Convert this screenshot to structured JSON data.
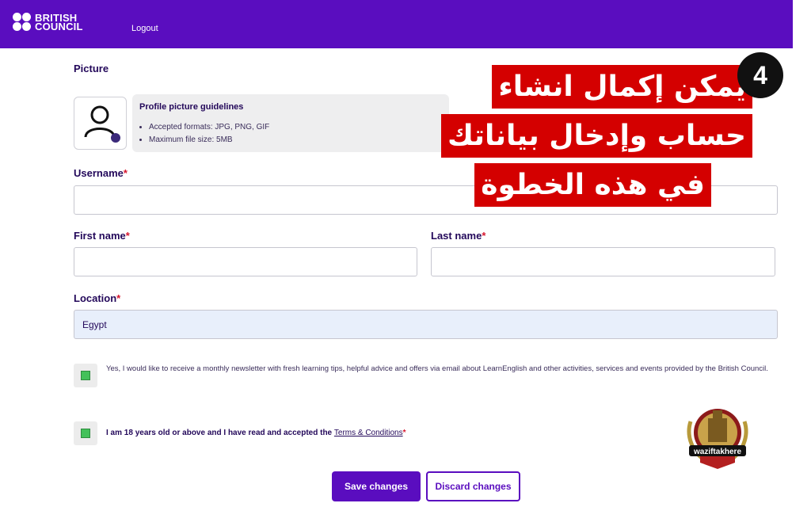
{
  "header": {
    "logo_line1": "BRITISH",
    "logo_line2": "COUNCIL",
    "logout": "Logout"
  },
  "picture": {
    "label": "Picture",
    "avatar_icon": "user-icon",
    "guidelines_title": "Profile picture guidelines",
    "guidelines": [
      "Accepted formats: JPG, PNG, GIF",
      "Maximum file size: 5MB"
    ]
  },
  "form": {
    "username_label": "Username",
    "username_value": "",
    "first_name_label": "First name",
    "first_name_value": "",
    "last_name_label": "Last name",
    "last_name_value": "",
    "location_label": "Location",
    "location_value": "Egypt",
    "required_mark": "*"
  },
  "consent": {
    "newsletter_text": "Yes, I would like to receive a monthly newsletter with fresh learning tips, helpful advice and offers via email about LearnEnglish and other activities, services and events provided by the British Council.",
    "newsletter_checked": true,
    "age_text": "I am 18 years old or above and I have read and accepted the ",
    "terms_link": "Terms & Conditions",
    "age_checked": true
  },
  "buttons": {
    "save": "Save changes",
    "discard": "Discard changes"
  },
  "overlay": {
    "lines": [
      "يمكن إكمال انشاء",
      "حساب وإدخال بياناتك",
      "في هذه الخطوة"
    ],
    "step_number": "4",
    "watermark": "waziftakhere"
  },
  "colors": {
    "brand": "#5a0dbf",
    "overlay_red": "#d40000",
    "required": "#d6162e"
  }
}
